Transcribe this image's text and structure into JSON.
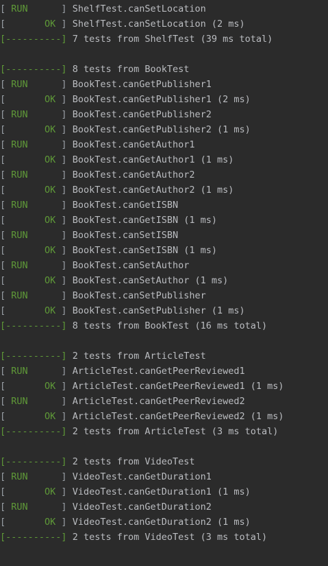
{
  "console": {
    "lines": [
      {
        "tag": "[ RUN      ]",
        "kind": "run",
        "text": "ShelfTest.canSetLocation"
      },
      {
        "tag": "[       OK ]",
        "kind": "ok",
        "text": "ShelfTest.canSetLocation (2 ms)"
      },
      {
        "tag": "[----------]",
        "kind": "sep",
        "text": "7 tests from ShelfTest (39 ms total)"
      },
      {
        "tag": "",
        "kind": "blank",
        "text": ""
      },
      {
        "tag": "[----------]",
        "kind": "sep",
        "text": "8 tests from BookTest"
      },
      {
        "tag": "[ RUN      ]",
        "kind": "run",
        "text": "BookTest.canGetPublisher1"
      },
      {
        "tag": "[       OK ]",
        "kind": "ok",
        "text": "BookTest.canGetPublisher1 (2 ms)"
      },
      {
        "tag": "[ RUN      ]",
        "kind": "run",
        "text": "BookTest.canGetPublisher2"
      },
      {
        "tag": "[       OK ]",
        "kind": "ok",
        "text": "BookTest.canGetPublisher2 (1 ms)"
      },
      {
        "tag": "[ RUN      ]",
        "kind": "run",
        "text": "BookTest.canGetAuthor1"
      },
      {
        "tag": "[       OK ]",
        "kind": "ok",
        "text": "BookTest.canGetAuthor1 (1 ms)"
      },
      {
        "tag": "[ RUN      ]",
        "kind": "run",
        "text": "BookTest.canGetAuthor2"
      },
      {
        "tag": "[       OK ]",
        "kind": "ok",
        "text": "BookTest.canGetAuthor2 (1 ms)"
      },
      {
        "tag": "[ RUN      ]",
        "kind": "run",
        "text": "BookTest.canGetISBN"
      },
      {
        "tag": "[       OK ]",
        "kind": "ok",
        "text": "BookTest.canGetISBN (1 ms)"
      },
      {
        "tag": "[ RUN      ]",
        "kind": "run",
        "text": "BookTest.canSetISBN"
      },
      {
        "tag": "[       OK ]",
        "kind": "ok",
        "text": "BookTest.canSetISBN (1 ms)"
      },
      {
        "tag": "[ RUN      ]",
        "kind": "run",
        "text": "BookTest.canSetAuthor"
      },
      {
        "tag": "[       OK ]",
        "kind": "ok",
        "text": "BookTest.canSetAuthor (1 ms)"
      },
      {
        "tag": "[ RUN      ]",
        "kind": "run",
        "text": "BookTest.canSetPublisher"
      },
      {
        "tag": "[       OK ]",
        "kind": "ok",
        "text": "BookTest.canSetPublisher (1 ms)"
      },
      {
        "tag": "[----------]",
        "kind": "sep",
        "text": "8 tests from BookTest (16 ms total)"
      },
      {
        "tag": "",
        "kind": "blank",
        "text": ""
      },
      {
        "tag": "[----------]",
        "kind": "sep",
        "text": "2 tests from ArticleTest"
      },
      {
        "tag": "[ RUN      ]",
        "kind": "run",
        "text": "ArticleTest.canGetPeerReviewed1"
      },
      {
        "tag": "[       OK ]",
        "kind": "ok",
        "text": "ArticleTest.canGetPeerReviewed1 (1 ms)"
      },
      {
        "tag": "[ RUN      ]",
        "kind": "run",
        "text": "ArticleTest.canGetPeerReviewed2"
      },
      {
        "tag": "[       OK ]",
        "kind": "ok",
        "text": "ArticleTest.canGetPeerReviewed2 (1 ms)"
      },
      {
        "tag": "[----------]",
        "kind": "sep",
        "text": "2 tests from ArticleTest (3 ms total)"
      },
      {
        "tag": "",
        "kind": "blank",
        "text": ""
      },
      {
        "tag": "[----------]",
        "kind": "sep",
        "text": "2 tests from VideoTest"
      },
      {
        "tag": "[ RUN      ]",
        "kind": "run",
        "text": "VideoTest.canGetDuration1"
      },
      {
        "tag": "[       OK ]",
        "kind": "ok",
        "text": "VideoTest.canGetDuration1 (1 ms)"
      },
      {
        "tag": "[ RUN      ]",
        "kind": "run",
        "text": "VideoTest.canGetDuration2"
      },
      {
        "tag": "[       OK ]",
        "kind": "ok",
        "text": "VideoTest.canGetDuration2 (1 ms)"
      },
      {
        "tag": "[----------]",
        "kind": "sep",
        "text": "2 tests from VideoTest (3 ms total)"
      }
    ]
  },
  "colors": {
    "background": "#2b2b2b",
    "status_green": "#5f9a38",
    "bracket_gray": "#9aa0a6",
    "text_gray": "#bbbdc1"
  }
}
